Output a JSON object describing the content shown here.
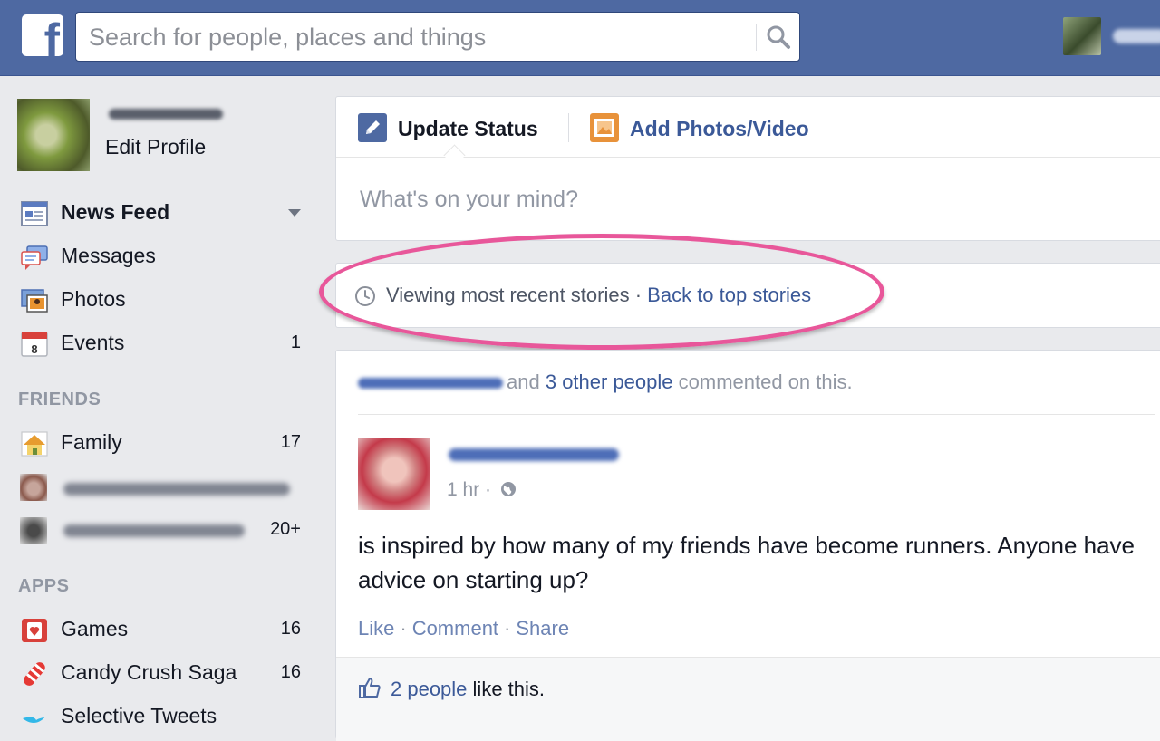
{
  "header": {
    "logo_letter": "f",
    "search_placeholder": "Search for people, places and things"
  },
  "sidebar": {
    "edit_profile": "Edit Profile",
    "favorites": [
      {
        "label": "News Feed",
        "count": "",
        "icon": "news-feed-icon"
      },
      {
        "label": "Messages",
        "count": "",
        "icon": "messages-icon"
      },
      {
        "label": "Photos",
        "count": "",
        "icon": "photos-icon"
      },
      {
        "label": "Events",
        "count": "1",
        "icon": "calendar-icon",
        "icon_text": "8"
      }
    ],
    "friends_heading": "FRIENDS",
    "friends": [
      {
        "label": "Family",
        "count": "17",
        "icon": "house-icon"
      },
      {
        "count": ""
      },
      {
        "count": "20+"
      }
    ],
    "apps_heading": "APPS",
    "apps": [
      {
        "label": "Games",
        "count": "16",
        "icon": "games-icon"
      },
      {
        "label": "Candy Crush Saga",
        "count": "16",
        "icon": "candy-icon"
      },
      {
        "label": "Selective Tweets",
        "count": "",
        "icon": "bird-icon"
      }
    ]
  },
  "composer": {
    "update_status": "Update Status",
    "add_photos": "Add Photos/Video",
    "placeholder": "What's on your mind?"
  },
  "recent": {
    "text": "Viewing most recent stories",
    "separator": " · ",
    "link": "Back to top stories"
  },
  "story": {
    "context_and": "and",
    "context_link": "3 other people",
    "context_tail": "commented on this.",
    "time": "1 hr",
    "meta_sep": " · ",
    "body": "is inspired by how many of my friends have become runners. Anyone have advice on starting up?",
    "actions": [
      "Like",
      "Comment",
      "Share"
    ],
    "likes_link": "2 people",
    "likes_tail": "like this."
  },
  "colors": {
    "header_blue": "#4e69a2",
    "link_blue": "#3b5998",
    "highlight_pink": "#e8579a"
  }
}
